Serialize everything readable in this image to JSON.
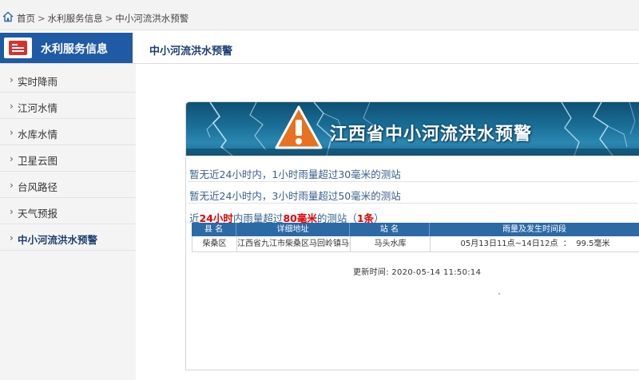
{
  "breadcrumb": {
    "home": "首页",
    "items": [
      "水利服务信息",
      "中小河流洪水预警"
    ],
    "separator": ">"
  },
  "sidebar": {
    "title": "水利服务信息",
    "items": [
      {
        "label": "实时降雨",
        "active": false
      },
      {
        "label": "江河水情",
        "active": false
      },
      {
        "label": "水库水情",
        "active": false
      },
      {
        "label": "卫星云图",
        "active": false
      },
      {
        "label": "台风路径",
        "active": false
      },
      {
        "label": "天气预报",
        "active": false
      },
      {
        "label": "中小河流洪水预警",
        "active": true
      }
    ]
  },
  "page_title": "中小河流洪水预警",
  "banner_title": "江西省中小河流洪水预警",
  "status": {
    "row1": {
      "pre": "暂无近24小时内，1小时雨量超过30毫米的测站"
    },
    "row2": {
      "pre": "暂无近24小时内，3小时雨量超过50毫米的测站"
    },
    "row3": {
      "p1": "近",
      "h1": "24小时",
      "p2": "内雨量超过",
      "h2": "80毫米",
      "p3": "的测站（",
      "h3": "1条",
      "p4": "）"
    }
  },
  "table": {
    "headers": [
      "县 名",
      "详细地址",
      "站 名",
      "雨量及发生时间段"
    ],
    "rows": [
      {
        "county": "柴桑区",
        "address": "江西省九江市柴桑区马回岭镇马头村",
        "station": "马头水库",
        "rain": "05月13日11点~14日12点  ：  99.5毫米"
      }
    ]
  },
  "update_time": "更新时间: 2020-05-14 11:50:14",
  "colors": {
    "accent": "#1f5aa5",
    "highlight": "#e00000",
    "table_head": "#2c6aa6"
  }
}
